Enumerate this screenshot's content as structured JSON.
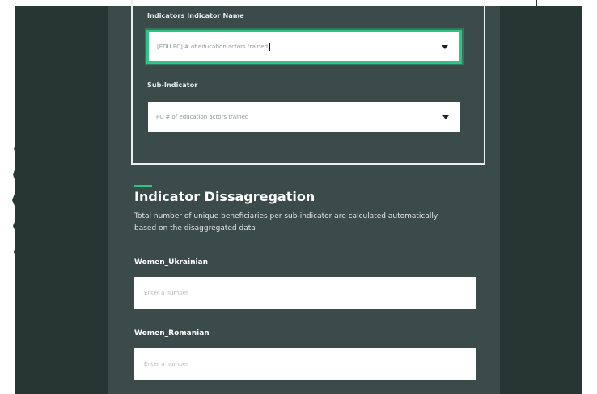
{
  "form": {
    "indicator_label": "Indicators Indicator Name",
    "indicator_value": "[EDU PC] # of education actors trained",
    "sub_indicator_label": "Sub-Indicator",
    "sub_indicator_value": "PC # of education actors trained"
  },
  "section": {
    "title": "Indicator Dissagregation",
    "description": "Total number of unique beneficiaries per sub-indicator are calculated automatically based on the disaggregated data"
  },
  "fields": [
    {
      "label": "Women_Ukrainian",
      "placeholder": "Enter a number"
    },
    {
      "label": "Women_Romanian",
      "placeholder": "Enter a number"
    }
  ],
  "colors": {
    "accent": "#2ec584",
    "page_background": "#263633",
    "content_background": "#3b4b4a"
  },
  "icons": {
    "dropdown": "chevron-down-icon"
  }
}
